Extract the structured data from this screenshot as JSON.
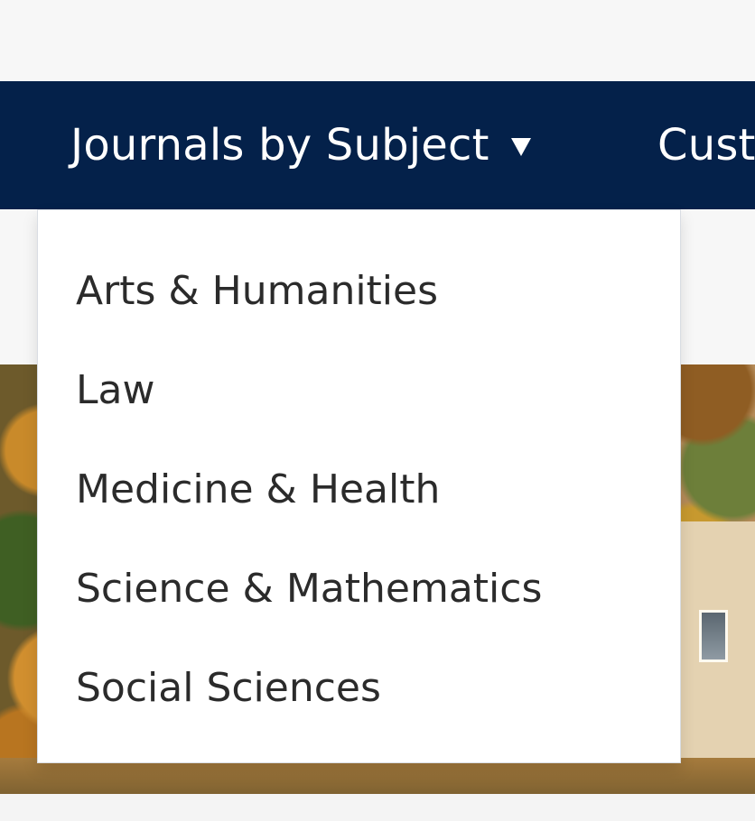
{
  "nav": {
    "items": [
      {
        "label": "Journals by Subject",
        "icon": "caret-down-icon"
      },
      {
        "label": "Cust"
      }
    ]
  },
  "dropdown": {
    "items": [
      {
        "label": "Arts & Humanities"
      },
      {
        "label": "Law"
      },
      {
        "label": "Medicine & Health"
      },
      {
        "label": "Science & Mathematics"
      },
      {
        "label": "Social Sciences"
      }
    ]
  },
  "colors": {
    "nav_background": "#04214a",
    "nav_text": "#ffffff",
    "menu_background": "#ffffff",
    "menu_text": "#2b2b2b",
    "page_background": "#f7f7f7"
  }
}
